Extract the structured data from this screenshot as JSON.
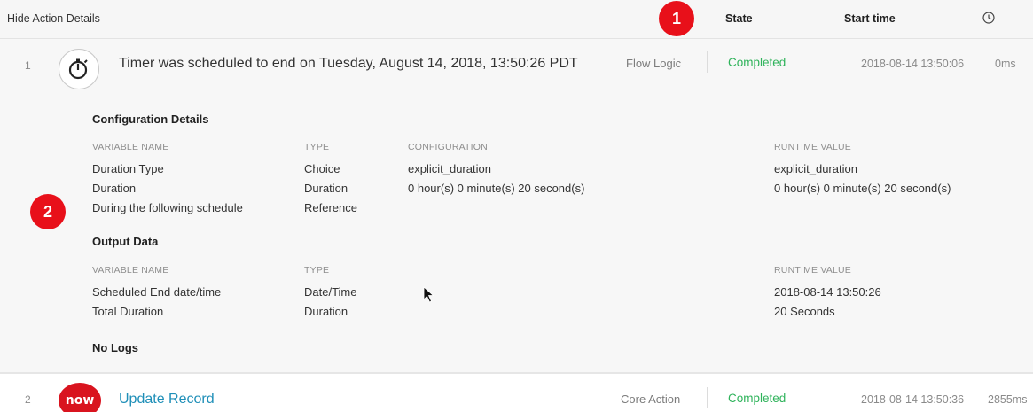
{
  "header": {
    "hide_link": "Hide Action Details",
    "col_state": "State",
    "col_start_time": "Start time",
    "clock_icon": "clock-icon"
  },
  "callouts": {
    "one": "1",
    "two": "2"
  },
  "rows": [
    {
      "index": "1",
      "icon": "timer-icon",
      "title": "Timer was scheduled to end on Tuesday, August 14, 2018, 13:50:26 PDT",
      "action_type": "Flow Logic",
      "state": "Completed",
      "start_time": "2018-08-14 13:50:06",
      "duration": "0ms"
    },
    {
      "index": "2",
      "icon": "now-icon",
      "icon_text": "now",
      "title": "Update Record",
      "action_type": "Core Action",
      "state": "Completed",
      "start_time": "2018-08-14 13:50:36",
      "duration": "2855ms"
    }
  ],
  "config": {
    "title": "Configuration Details",
    "headers": {
      "variable": "VARIABLE NAME",
      "type": "TYPE",
      "configuration": "CONFIGURATION",
      "runtime": "RUNTIME VALUE"
    },
    "items": [
      {
        "name": "Duration Type",
        "type": "Choice",
        "configuration": "explicit_duration",
        "runtime": "explicit_duration"
      },
      {
        "name": "Duration",
        "type": "Duration",
        "configuration": "0 hour(s) 0 minute(s) 20 second(s)",
        "runtime": "0 hour(s) 0 minute(s) 20 second(s)"
      },
      {
        "name": "During the following schedule",
        "type": "Reference",
        "configuration": "",
        "runtime": ""
      }
    ]
  },
  "output": {
    "title": "Output Data",
    "headers": {
      "variable": "VARIABLE NAME",
      "type": "TYPE",
      "runtime": "RUNTIME VALUE"
    },
    "items": [
      {
        "name": "Scheduled End date/time",
        "type": "Date/Time",
        "runtime": "2018-08-14 13:50:26"
      },
      {
        "name": "Total Duration",
        "type": "Duration",
        "runtime": "20 Seconds"
      }
    ]
  },
  "logs": {
    "label": "No Logs"
  },
  "colors": {
    "state_green": "#2fb35b",
    "link_blue": "#1f8fb8",
    "callout_red": "#e8101a",
    "now_red": "#d9141f"
  }
}
